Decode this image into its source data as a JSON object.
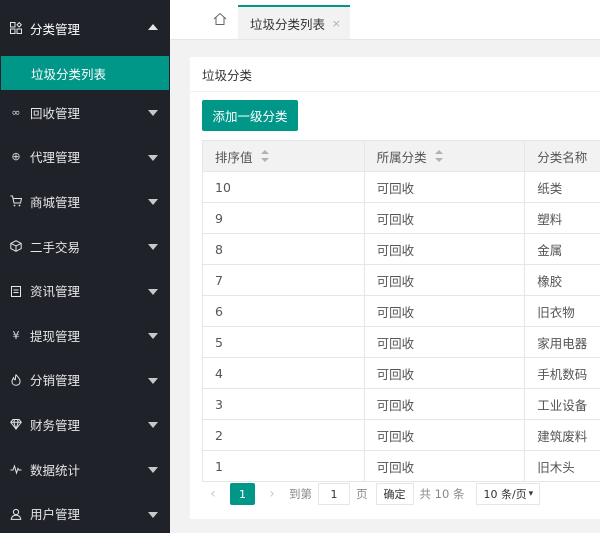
{
  "sidebar": {
    "items": [
      {
        "label": "分类管理",
        "icon": "category-icon",
        "open": true
      },
      {
        "label": "回收管理",
        "icon": "recycle-icon"
      },
      {
        "label": "代理管理",
        "icon": "agent-icon"
      },
      {
        "label": "商城管理",
        "icon": "cart-icon"
      },
      {
        "label": "二手交易",
        "icon": "box-icon"
      },
      {
        "label": "资讯管理",
        "icon": "news-icon"
      },
      {
        "label": "提现管理",
        "icon": "yen-icon"
      },
      {
        "label": "分销管理",
        "icon": "fire-icon"
      },
      {
        "label": "财务管理",
        "icon": "diamond-icon"
      },
      {
        "label": "数据统计",
        "icon": "pulse-icon"
      },
      {
        "label": "用户管理",
        "icon": "user-icon"
      }
    ],
    "sub_item": "垃圾分类列表"
  },
  "tabs": {
    "home_icon": "home-icon",
    "active_label": "垃圾分类列表",
    "close": "×"
  },
  "card": {
    "title": "垃圾分类",
    "add_button": "添加一级分类"
  },
  "table": {
    "headers": [
      "排序值",
      "所属分类",
      "分类名称"
    ],
    "rows": [
      [
        "10",
        "可回收",
        "纸类"
      ],
      [
        "9",
        "可回收",
        "塑料"
      ],
      [
        "8",
        "可回收",
        "金属"
      ],
      [
        "7",
        "可回收",
        "橡胶"
      ],
      [
        "6",
        "可回收",
        "旧衣物"
      ],
      [
        "5",
        "可回收",
        "家用电器"
      ],
      [
        "4",
        "可回收",
        "手机数码"
      ],
      [
        "3",
        "可回收",
        "工业设备"
      ],
      [
        "2",
        "可回收",
        "建筑废料"
      ],
      [
        "1",
        "可回收",
        "旧木头"
      ]
    ]
  },
  "pager": {
    "prev": "‹",
    "current": "1",
    "next": "›",
    "goto_label": "到第",
    "goto_value": "1",
    "page_label": "页",
    "confirm": "确定",
    "total": "共 10 条",
    "page_size": "10 条/页"
  },
  "colors": {
    "accent": "#009688",
    "sidebar_bg": "#20222a"
  }
}
